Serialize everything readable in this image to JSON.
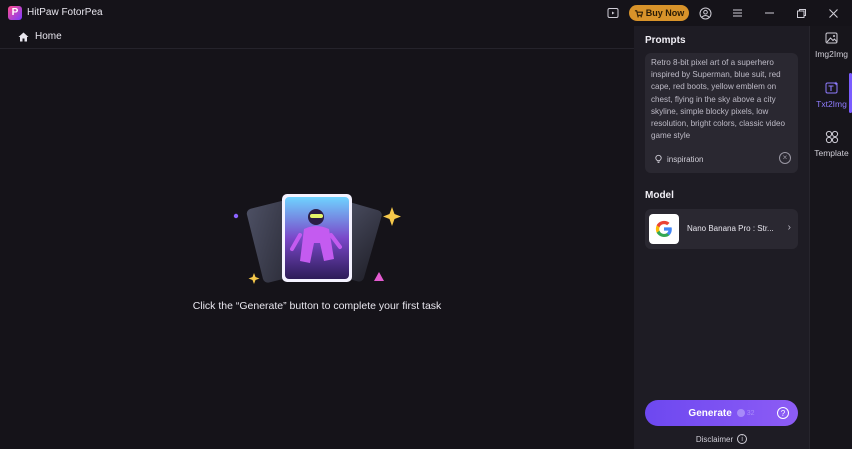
{
  "app": {
    "title": "HitPaw FotorPea",
    "logo_letter": "P"
  },
  "titlebar": {
    "buy_now_label": "Buy Now"
  },
  "nav": {
    "home_label": "Home"
  },
  "canvas": {
    "hint": "Click the “Generate” button to complete your first task"
  },
  "panel": {
    "prompts_title": "Prompts",
    "prompt_text": "Retro 8-bit pixel art of a superhero inspired by Superman, blue suit, red cape, red boots, yellow emblem on chest, flying in the sky above a city skyline, simple blocky pixels, low resolution, bright colors, classic video game style",
    "inspiration_label": "inspiration",
    "model_title": "Model",
    "model_name": "Nano Banana Pro : Str...",
    "generate_label": "Generate",
    "generate_credits": "32",
    "disclaimer_label": "Disclaimer"
  },
  "sidebar": {
    "items": [
      {
        "label": "Img2Img",
        "icon": "image-edit-icon"
      },
      {
        "label": "Txt2Img",
        "icon": "text-image-icon",
        "active": true
      },
      {
        "label": "Template",
        "icon": "template-icon"
      }
    ]
  },
  "colors": {
    "accent": "#7b5cff",
    "buy_now": "#d8932a",
    "panel_bg": "#1e1c24",
    "background": "#151319"
  }
}
